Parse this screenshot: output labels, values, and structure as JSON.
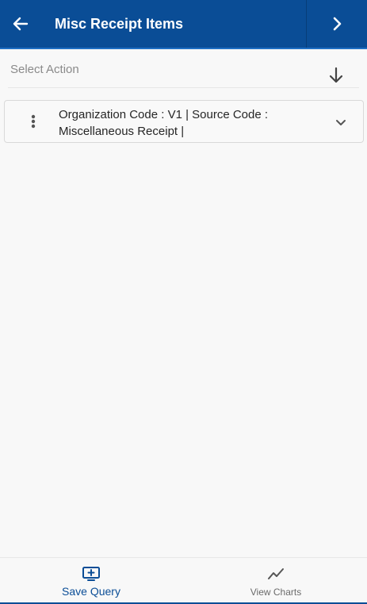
{
  "header": {
    "title": "Misc Receipt Items",
    "back_icon": "arrow-left-icon",
    "next_icon": "chevron-right-icon"
  },
  "action_bar": {
    "select_label": "Select Action",
    "download_icon": "arrow-down-icon"
  },
  "list": {
    "items": [
      {
        "text": "Organization Code : V1 | Source Code : Miscellaneous Receipt |"
      }
    ]
  },
  "footer": {
    "save_query_label": "Save Query",
    "view_charts_label": "View Charts"
  },
  "colors": {
    "brand": "#0a4d96",
    "background": "#f8f8f8"
  }
}
